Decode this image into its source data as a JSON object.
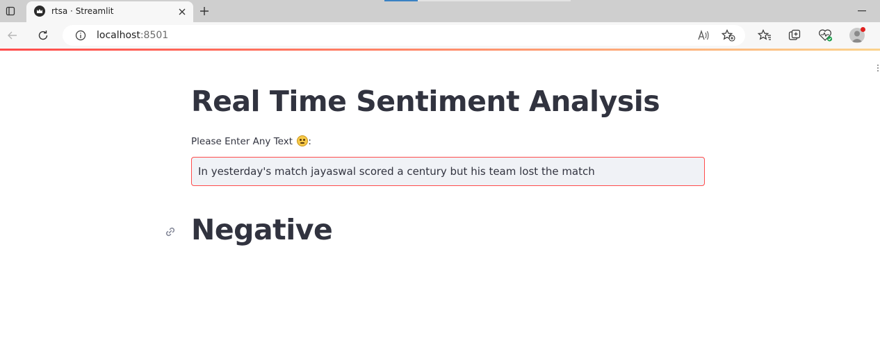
{
  "browser": {
    "tab": {
      "title": "rtsa · Streamlit",
      "favicon": "streamlit-crown-icon"
    },
    "address": {
      "host": "localhost",
      "port": ":8501"
    },
    "icons": [
      "tab-actions-icon",
      "close-icon",
      "plus-icon",
      "minimize-icon",
      "back-arrow-icon",
      "refresh-icon",
      "info-icon",
      "read-aloud-icon",
      "add-favorite-icon",
      "favorites-icon",
      "collections-icon",
      "browser-essentials-icon",
      "profile-avatar-icon"
    ],
    "accent_color": "#ff4b4b"
  },
  "app": {
    "title": "Real Time Sentiment Analysis",
    "input_label": "Please Enter Any Text",
    "input_label_suffix": ":",
    "input_value": "In yesterday's match jayaswal scored a century but his team lost the match",
    "result": "Negative"
  }
}
